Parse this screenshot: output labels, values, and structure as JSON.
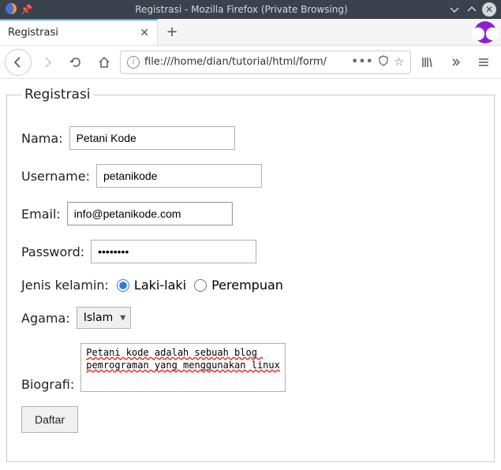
{
  "window": {
    "title": "Registrasi - Mozilla Firefox (Private Browsing)"
  },
  "tab": {
    "label": "Registrasi"
  },
  "urlbar": {
    "url": "file:///home/dian/tutorial/html/form/"
  },
  "form": {
    "legend": "Registrasi",
    "nama": {
      "label": "Nama:",
      "value": "Petani Kode"
    },
    "username": {
      "label": "Username:",
      "value": "petanikode"
    },
    "email": {
      "label": "Email:",
      "value": "info@petanikode.com"
    },
    "password": {
      "label": "Password:",
      "value": "••••••••"
    },
    "gender": {
      "label": "Jenis kelamin:",
      "options": {
        "male": "Laki-laki",
        "female": "Perempuan"
      },
      "selected": "male"
    },
    "agama": {
      "label": "Agama:",
      "value": "Islam"
    },
    "biografi": {
      "label": "Biografi:",
      "value": "Petani kode adalah sebuah blog pemrograman yang menggunakan linux"
    },
    "submit": "Daftar"
  }
}
